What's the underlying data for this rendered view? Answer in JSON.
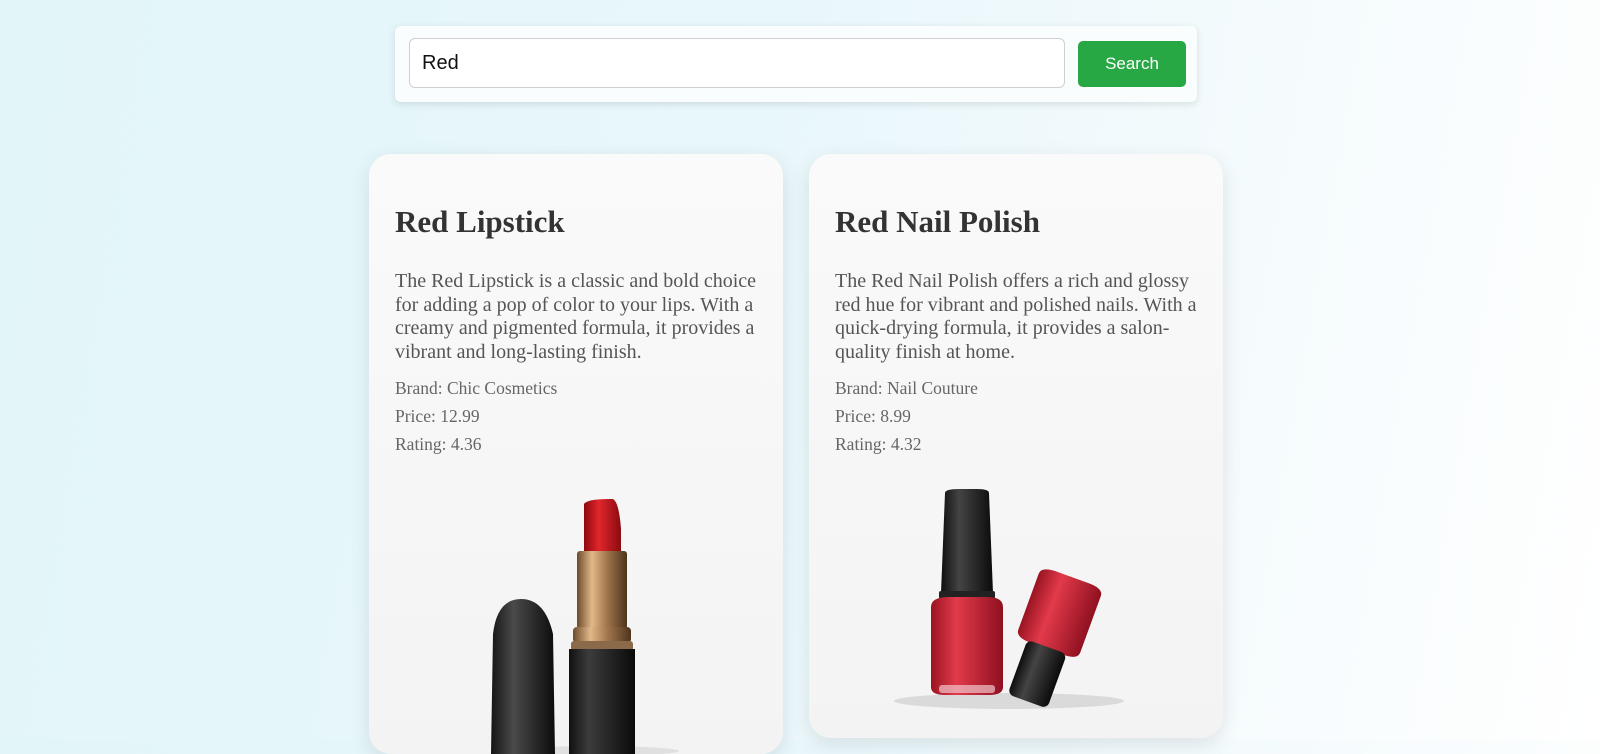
{
  "search": {
    "value": "Red",
    "button_label": "Search"
  },
  "products": [
    {
      "title": "Red Lipstick",
      "description": "The Red Lipstick is a classic and bold choice for adding a pop of color to your lips. With a creamy and pigmented formula, it provides a vibrant and long-lasting finish.",
      "brand": "Brand: Chic Cosmetics",
      "price": "Price: 12.99",
      "rating": "Rating: 4.36"
    },
    {
      "title": "Red Nail Polish",
      "description": "The Red Nail Polish offers a rich and glossy red hue for vibrant and polished nails. With a quick-drying formula, it provides a salon-quality finish at home.",
      "brand": "Brand: Nail Couture",
      "price": "Price: 8.99",
      "rating": "Rating: 4.32"
    }
  ],
  "colors": {
    "search_button": "#28a745",
    "lipstick_red": "#c8161c",
    "polish_red": "#d42a3a"
  }
}
